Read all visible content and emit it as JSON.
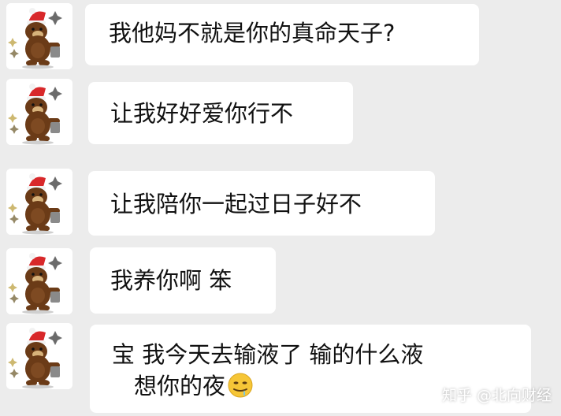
{
  "messages": [
    {
      "sender_avatar": "bear-avatar",
      "lines": [
        "我他妈不就是你的真命天子?"
      ]
    },
    {
      "sender_avatar": "bear-avatar",
      "lines": [
        "让我好好爱你行不"
      ]
    },
    {
      "sender_avatar": "bear-avatar",
      "lines": [
        "让我陪你一起过日子好不"
      ]
    },
    {
      "sender_avatar": "bear-avatar",
      "lines": [
        "我养你啊 笨"
      ]
    },
    {
      "sender_avatar": "bear-avatar",
      "lines": [
        "宝  我今天去输液了   输的什么液",
        "想你的夜"
      ],
      "trailing_emoji": "drooling-face-emoji"
    }
  ],
  "watermark": "知乎 @北向财经",
  "colors": {
    "background": "#ececec",
    "bubble": "#ffffff",
    "text": "#111111"
  }
}
